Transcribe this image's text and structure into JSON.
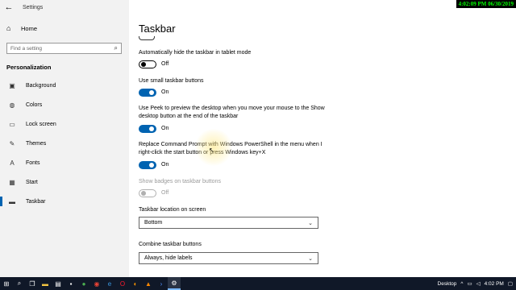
{
  "window": {
    "app_title": "Settings"
  },
  "overlay": {
    "clock": "4:02:09 PM 06/30/2019"
  },
  "sidebar": {
    "home_label": "Home",
    "search_placeholder": "Find a setting",
    "section": "Personalization",
    "items": [
      {
        "label": "Background",
        "icon": "picture-icon"
      },
      {
        "label": "Colors",
        "icon": "palette-icon"
      },
      {
        "label": "Lock screen",
        "icon": "monitor-lock-icon"
      },
      {
        "label": "Themes",
        "icon": "brush-icon"
      },
      {
        "label": "Fonts",
        "icon": "font-icon"
      },
      {
        "label": "Start",
        "icon": "start-grid-icon"
      },
      {
        "label": "Taskbar",
        "icon": "taskbar-icon",
        "selected": true
      }
    ]
  },
  "main": {
    "title": "Taskbar",
    "settings": [
      {
        "label": "Automatically hide the taskbar in tablet mode",
        "state": "Off"
      },
      {
        "label": "Use small taskbar buttons",
        "state": "On"
      },
      {
        "label": "Use Peek to preview the desktop when you move your mouse to the Show desktop button at the end of the taskbar",
        "state": "On"
      },
      {
        "label": "Replace Command Prompt with Windows PowerShell in the menu when I right-click the start button or press Windows key+X",
        "state": "On"
      },
      {
        "label": "Show badges on taskbar buttons",
        "state": "Off"
      }
    ],
    "location_label": "Taskbar location on screen",
    "location_value": "Bottom",
    "combine_label": "Combine taskbar buttons",
    "combine_value": "Always, hide labels"
  },
  "taskbar": {
    "desktop_label": "Desktop",
    "time": "4:02 PM"
  },
  "colors": {
    "accent": "#0063b1",
    "taskbar": "#101828"
  }
}
